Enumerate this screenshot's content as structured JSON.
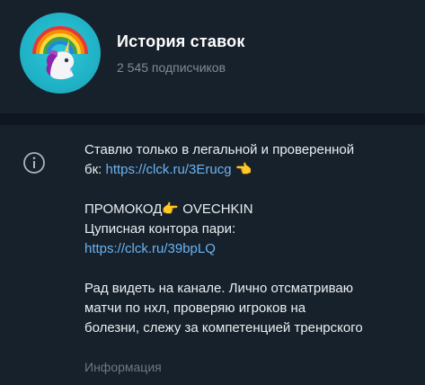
{
  "channel": {
    "title": "История ставок",
    "subscribers": "2 545 подписчиков",
    "avatar_icon": "unicorn-rainbow-icon"
  },
  "info_icon": "info-circle-icon",
  "description": {
    "line1": "Ставлю только в легальной и проверенной",
    "line2_prefix": "бк: ",
    "link1": "https://clck.ru/3Erucg",
    "link1_emoji": "👈",
    "promo_prefix": "ПРОМОКОД",
    "promo_emoji": "👉",
    "promo_code": " OVECHKIN",
    "line_contora": "Цуписная контора пари:",
    "link2": "https://clck.ru/39bpLQ",
    "para1": "Рад видеть на канале. Лично отсматриваю",
    "para2": "матчи по нхл, проверяю игроков на",
    "para3": "болезни, слежу за компетенцией тренрского"
  },
  "caption": "Информация",
  "colors": {
    "background": "#17212b",
    "separator": "#0e1621",
    "link": "#6ab3f3",
    "muted": "#7d8b99",
    "avatar": "#20b3c7"
  }
}
